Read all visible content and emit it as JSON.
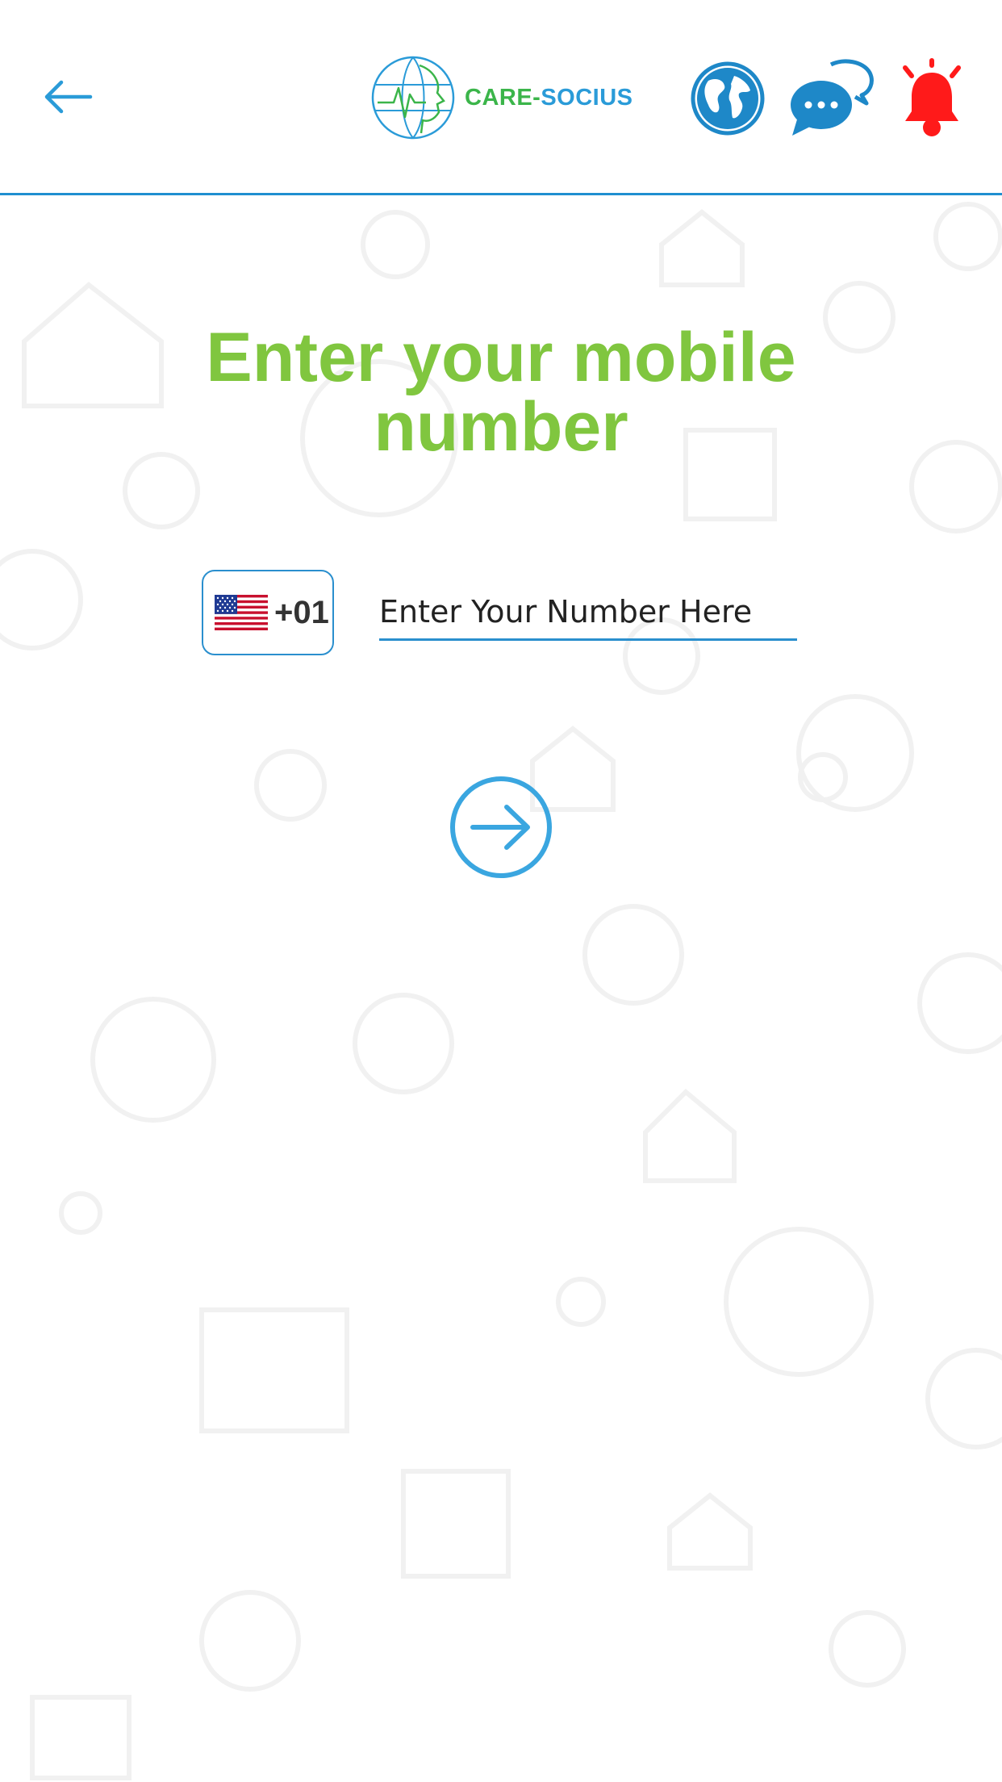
{
  "header": {
    "back_icon": "arrow-left-icon",
    "logo": {
      "brand_left": "CARE-",
      "brand_right": "SOCIUS"
    },
    "actions": [
      {
        "name": "language",
        "icon": "globe-icon"
      },
      {
        "name": "messages",
        "icon": "chat-bubbles-icon"
      },
      {
        "name": "alerts",
        "icon": "bell-icon"
      }
    ]
  },
  "main": {
    "title_line1": "Enter your mobile",
    "title_line2": "number",
    "country": {
      "flag_icon": "us-flag-icon",
      "code": "+01"
    },
    "phone_input": {
      "value": "",
      "placeholder": "Enter Your Number Here"
    },
    "next_icon": "arrow-right-circle-icon"
  },
  "colors": {
    "accent_blue": "#2a8fce",
    "title_green": "#80c63f",
    "brand_green": "#3bb54a",
    "brand_blue": "#2a9bd8",
    "bell_red": "#ff1a1a",
    "globe_blue": "#1e88c8"
  }
}
